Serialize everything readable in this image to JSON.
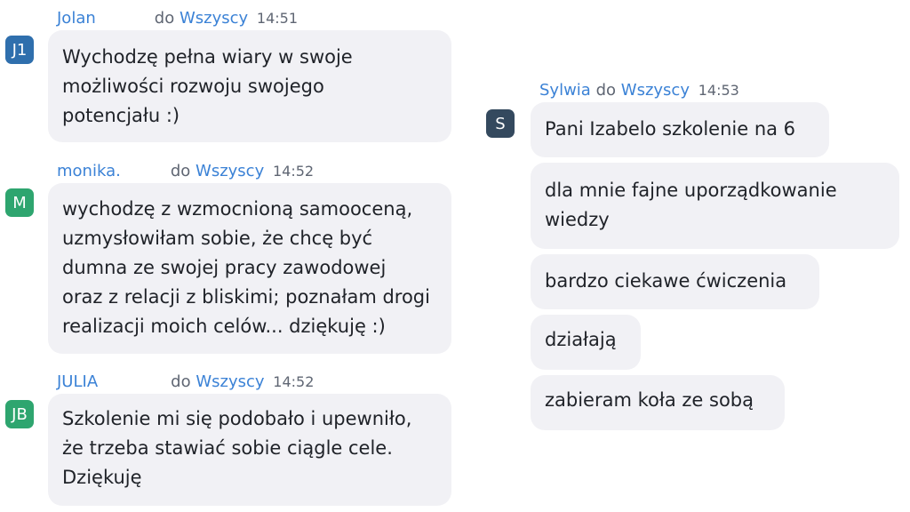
{
  "colors": {
    "link": "#3b82d6",
    "meta_text": "#5f6673",
    "bubble_bg": "#f1f1f5",
    "message_text": "#1f2228",
    "avatar_j1": "#2f6fad",
    "avatar_m": "#2ea56f",
    "avatar_jb": "#2ea56f",
    "avatar_s": "#34495e"
  },
  "to_word": "do",
  "target": "Wszyscy",
  "messages": [
    {
      "avatar": "J1",
      "sender": "Jolan",
      "time": "14:51",
      "lines": [
        "Wychodzę pełna wiary w swoje",
        "możliwości rozwoju swojego",
        "potencjału :)"
      ]
    },
    {
      "avatar": "M",
      "sender": "monika.",
      "time": "14:52",
      "lines": [
        "wychodzę z wzmocnioną samooceną,",
        "uzmysłowiłam sobie, że chcę być",
        "dumna ze swojej pracy zawodowej",
        "oraz z relacji z bliskimi; poznałam drogi",
        "realizacji moich celów... dziękuję :)"
      ]
    },
    {
      "avatar": "JB",
      "sender": "JULIA",
      "time": "14:52",
      "lines": [
        "Szkolenie mi się podobało i upewniło,",
        "że trzeba stawiać sobie ciągle cele.",
        "Dziękuję"
      ]
    },
    {
      "avatar": "S",
      "sender": "Sylwia",
      "time": "14:53",
      "bubbles": [
        [
          "Pani Izabelo szkolenie na 6"
        ],
        [
          "dla mnie fajne uporządkowanie",
          "wiedzy"
        ],
        [
          "bardzo ciekawe ćwiczenia"
        ],
        [
          "działają"
        ],
        [
          "zabieram koła ze sobą"
        ]
      ]
    }
  ]
}
